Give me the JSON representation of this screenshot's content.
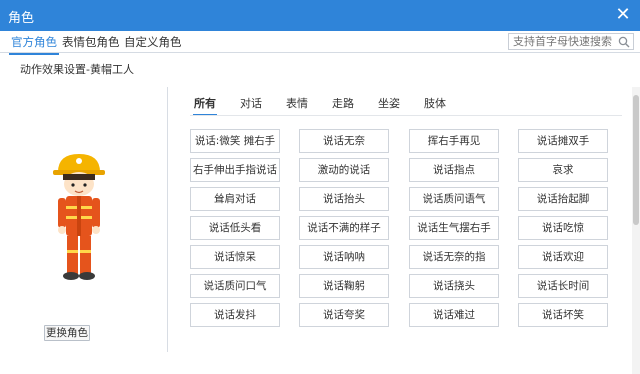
{
  "window": {
    "title": "角色",
    "close_glyph": "✕"
  },
  "tabs": [
    {
      "label": "官方角色",
      "active": true
    },
    {
      "label": "表情包角色",
      "active": false
    },
    {
      "label": "自定义角色",
      "active": false
    }
  ],
  "search": {
    "placeholder": "支持首字母快速搜索",
    "icon": "search-icon"
  },
  "subtitle": "动作效果设置-黄帽工人",
  "left_panel": {
    "change_button": "更换角色"
  },
  "categories": [
    "所有",
    "对话",
    "表情",
    "走路",
    "坐姿",
    "肢体"
  ],
  "active_category": "所有",
  "actions": [
    [
      "说话:微笑 摊右手",
      "说话无奈",
      "挥右手再见",
      "说话摊双手"
    ],
    [
      "右手伸出手指说话",
      "激动的说话",
      "说话指点",
      "哀求"
    ],
    [
      "耸肩对话",
      "说话抬头",
      "说话质问语气",
      "说话抬起脚"
    ],
    [
      "说话低头看",
      "说话不满的样子",
      "说话生气摆右手",
      "说话吃惊"
    ],
    [
      "说话惊呆",
      "说话呐呐",
      "说话无奈的指",
      "说话欢迎"
    ],
    [
      "说话质问口气",
      "说话鞠躬",
      "说话挠头",
      "说话长时间"
    ],
    [
      "说话发抖",
      "说话夸奖",
      "说话难过",
      "说话坏笑"
    ]
  ],
  "colors": {
    "accent": "#2f84d9",
    "helmet": "#f5b400",
    "uniform": "#e5541c"
  }
}
